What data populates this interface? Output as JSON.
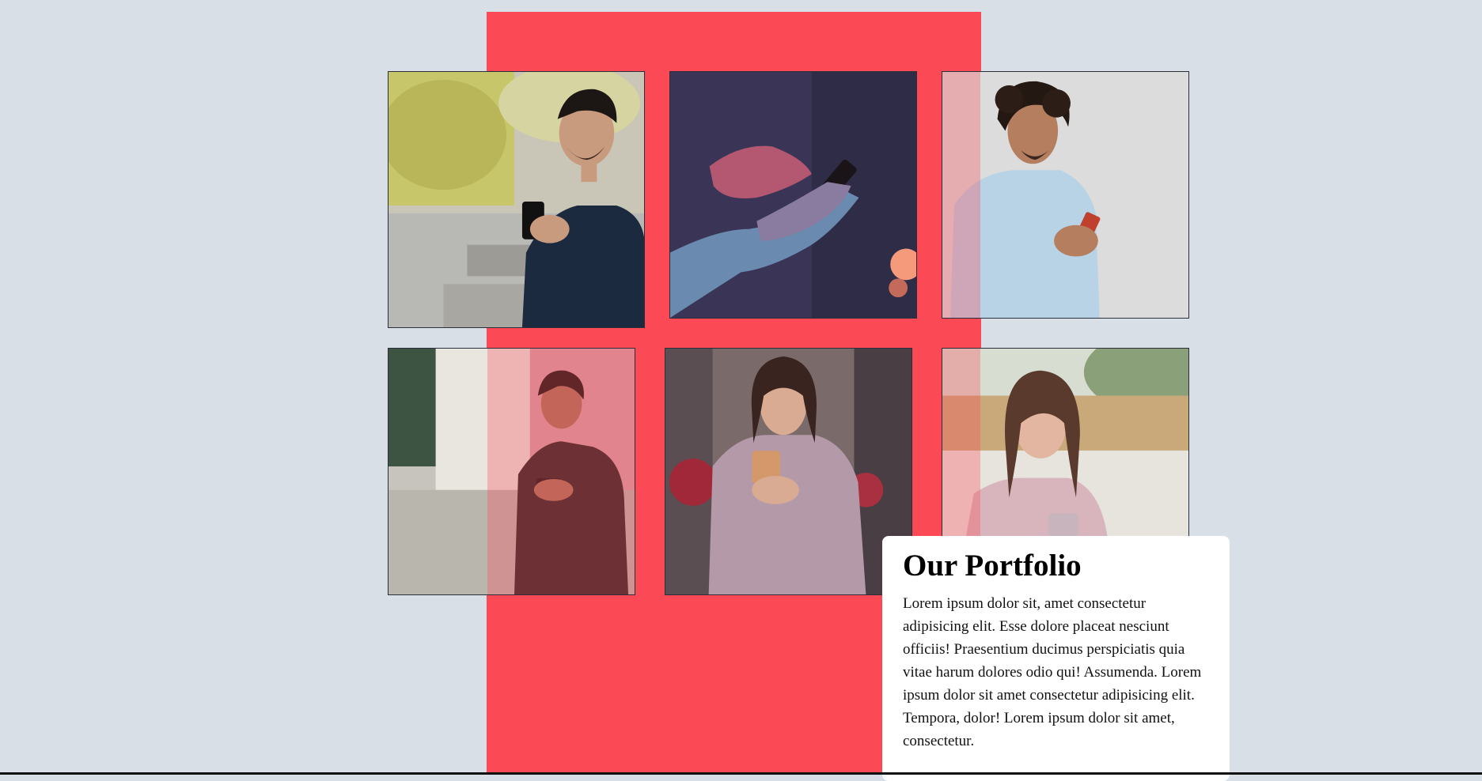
{
  "portfolio": {
    "title": "Our Portfolio",
    "description": "Lorem ipsum dolor sit, amet consectetur adipisicing elit. Esse dolore placeat nesciunt officiis! Praesentium ducimus perspiciatis quia vitae harum dolores odio qui! Assumenda. Lorem ipsum dolor sit amet consectetur adipisicing elit. Tempora, dolor! Lorem ipsum dolor sit amet, consectetur."
  },
  "colors": {
    "background": "#d8dfe6",
    "accent": "#fb4a56",
    "card": "#ffffff"
  },
  "gallery": {
    "photos": [
      {
        "name": "man-in-dark-shirt-with-phone"
      },
      {
        "name": "hands-holding-phone"
      },
      {
        "name": "curly-haired-man-with-phone"
      },
      {
        "name": "young-man-in-leather-jacket-with-phone"
      },
      {
        "name": "woman-in-blazer-with-phone"
      },
      {
        "name": "smiling-woman-with-phone"
      }
    ]
  }
}
